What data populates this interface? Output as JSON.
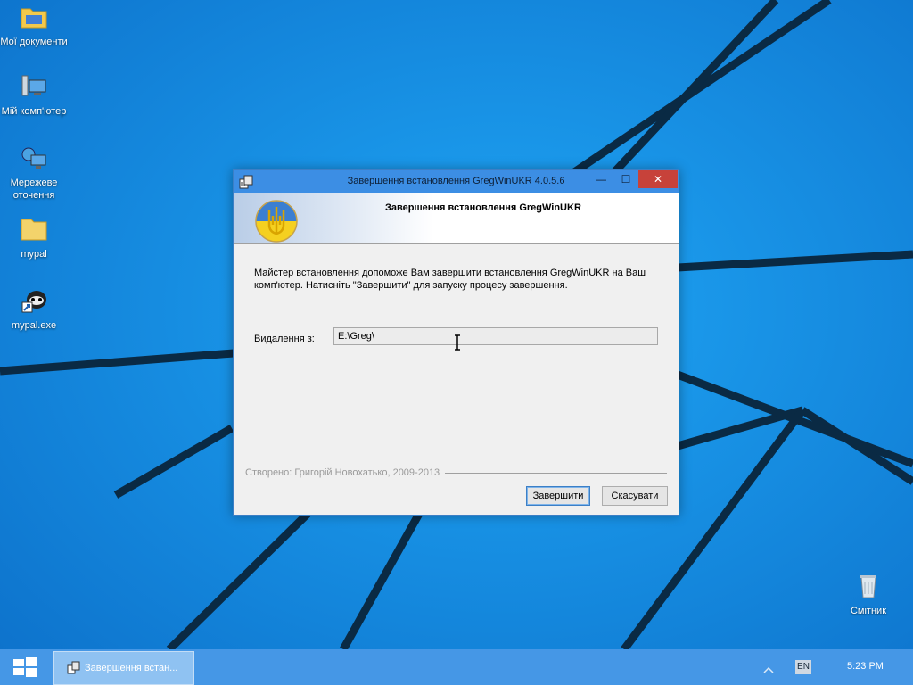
{
  "desktop": {
    "icons": [
      {
        "label": "Мої документи",
        "icon": "folder-icon"
      },
      {
        "label": "Мій комп'ютер",
        "icon": "computer-icon"
      },
      {
        "label": "Мережеве оточення",
        "icon": "network-icon"
      },
      {
        "label": "mypal",
        "icon": "folder-icon"
      },
      {
        "label": "mypal.exe",
        "icon": "raccoon-app-icon"
      },
      {
        "label": "Смітник",
        "icon": "recycle-bin-icon"
      }
    ]
  },
  "window": {
    "title": "Завершення встановлення GregWinUKR 4.0.5.6",
    "controls": {
      "minimize": "—",
      "maximize": "☐",
      "close": "✕"
    },
    "header_title": "Завершення встановлення GregWinUKR",
    "description": "Майстер встановлення допоможе Вам завершити встановлення GregWinUKR на Ваш комп'ютер. Натисніть \"Завершити\" для запуску процесу завершення.",
    "field_label": "Видалення з:",
    "field_value": "E:\\Greg\\",
    "credits": "Створено: Григорій Новохатько, 2009-2013",
    "finish_button": "Завершити",
    "cancel_button": "Скасувати"
  },
  "taskbar": {
    "task_label": "Завершення встан...",
    "language": "EN",
    "time": "5:23 PM"
  },
  "colors": {
    "wallpaper": "#1a8fe6",
    "title_bar": "#3c8ee4",
    "close_button": "#c7423a",
    "taskbar": "#4597e6"
  }
}
